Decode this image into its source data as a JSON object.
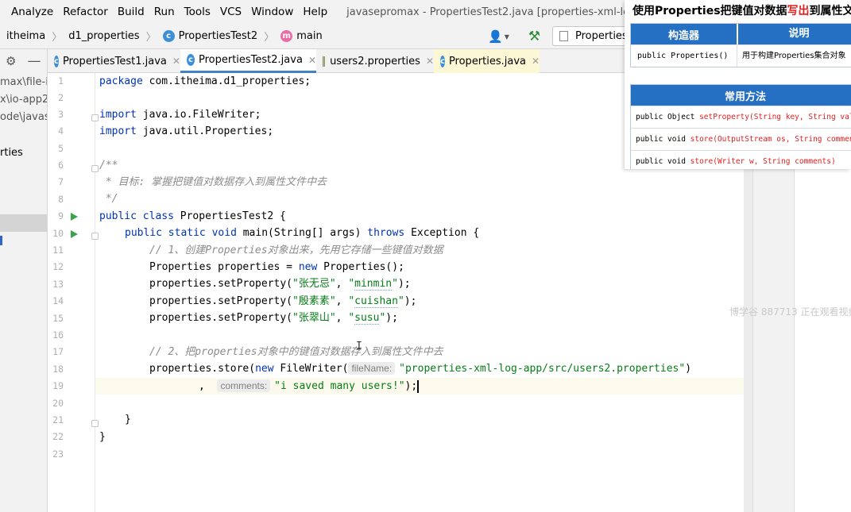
{
  "menu": {
    "items": [
      "Analyze",
      "Refactor",
      "Build",
      "Run",
      "Tools",
      "VCS",
      "Window",
      "Help"
    ]
  },
  "window_title": "javasepromax - PropertiesTest2.java [properties-xml-log-app]",
  "breadcrumb": {
    "items": [
      "itheima",
      "d1_properties",
      "PropertiesTest2",
      "main"
    ]
  },
  "toolbar": {
    "run_config": "Properties"
  },
  "project_tree": {
    "items": [
      "max\\file-io",
      "x\\io-app2",
      "ode\\javase",
      "rties"
    ]
  },
  "tabs": [
    {
      "label": "PropertiesTest1.java"
    },
    {
      "label": "PropertiesTest2.java"
    },
    {
      "label": "users2.properties"
    },
    {
      "label": "Properties.java"
    }
  ],
  "editor": {
    "line_numbers": [
      "1",
      "2",
      "3",
      "4",
      "5",
      "6",
      "7",
      "8",
      "9",
      "10",
      "11",
      "12",
      "13",
      "14",
      "15",
      "16",
      "17",
      "18",
      "19",
      "20",
      "21",
      "22",
      "23"
    ],
    "code": {
      "pkg_kw": "package",
      "pkg_name": " com.itheima.d1_properties;",
      "imp_kw": "import",
      "imp1": " java.io.FileWriter;",
      "imp2": " java.util.Properties;",
      "doc1": "/**",
      "doc2": " * 目标: 掌握把键值对数据存入到属性文件中去",
      "doc3": " */",
      "l9_kw1": "public",
      "l9_kw2": "class",
      "l9_name": " PropertiesTest2 {",
      "l10_kw1": "public",
      "l10_kw2": "static",
      "l10_kw3": "void",
      "l10_a": " main(String[] args) ",
      "l10_kw4": "throws",
      "l10_b": " Exception {",
      "c11": "// 1、创建Properties对象出来，先用它存储一些键值对数据",
      "l12_a": "Properties properties = ",
      "l12_kw": "new",
      "l12_b": " Properties();",
      "set_call": "properties.setProperty(",
      "k1": "\"张无忌\"",
      "v1a": "\"",
      "v1": "minmin",
      "v1b": "\"",
      "k2": "\"殷素素\"",
      "v2a": "\"",
      "v2": "cuishan",
      "v2b": "\"",
      "k3": "\"张翠山\"",
      "v3a": "\"",
      "v3": "susu",
      "v3b": "\"",
      "comma": ", ",
      "close": ");",
      "c17": "// 2、把properties对象中的键值对数据存入到属性文件中去",
      "l18_a": "properties.store(",
      "l18_kw": "new",
      "l18_b": " FileWriter(",
      "hint_filename": "fileName:",
      "l18_str": "\"properties-xml-log-app/src/users2.properties\"",
      "l18_c": ")",
      "l19_comma": ",",
      "hint_comments": "comments:",
      "l19_str": "\"i saved many users!\"",
      "l19_c": ");",
      "brace": "}"
    }
  },
  "watermark": "博学谷 887713 正在观看视频",
  "overlay": {
    "title_a": "使用Properties把键值对数据",
    "title_red": "写出",
    "title_b": "到属性文件",
    "table1": {
      "headers": [
        "构造器",
        "说明"
      ],
      "rows": [
        {
          "sig": "public Properties()",
          "desc": "用于构建Properties集合对象"
        }
      ]
    },
    "table2": {
      "header": "常用方法",
      "rows": [
        {
          "prefix": "public Object ",
          "method": "setProperty(String key, String value)"
        },
        {
          "prefix": "public void ",
          "method": "store(OutputStream os, String comments)"
        },
        {
          "prefix": "public void ",
          "method": "store(Writer w, String comments)"
        }
      ]
    }
  },
  "colors": {
    "keyword": "#0033b3",
    "string": "#067d17",
    "comment": "#8c8c8c",
    "accent": "#2570c3",
    "highlight_red": "#e22020",
    "run_icon": "#3aa64a"
  }
}
